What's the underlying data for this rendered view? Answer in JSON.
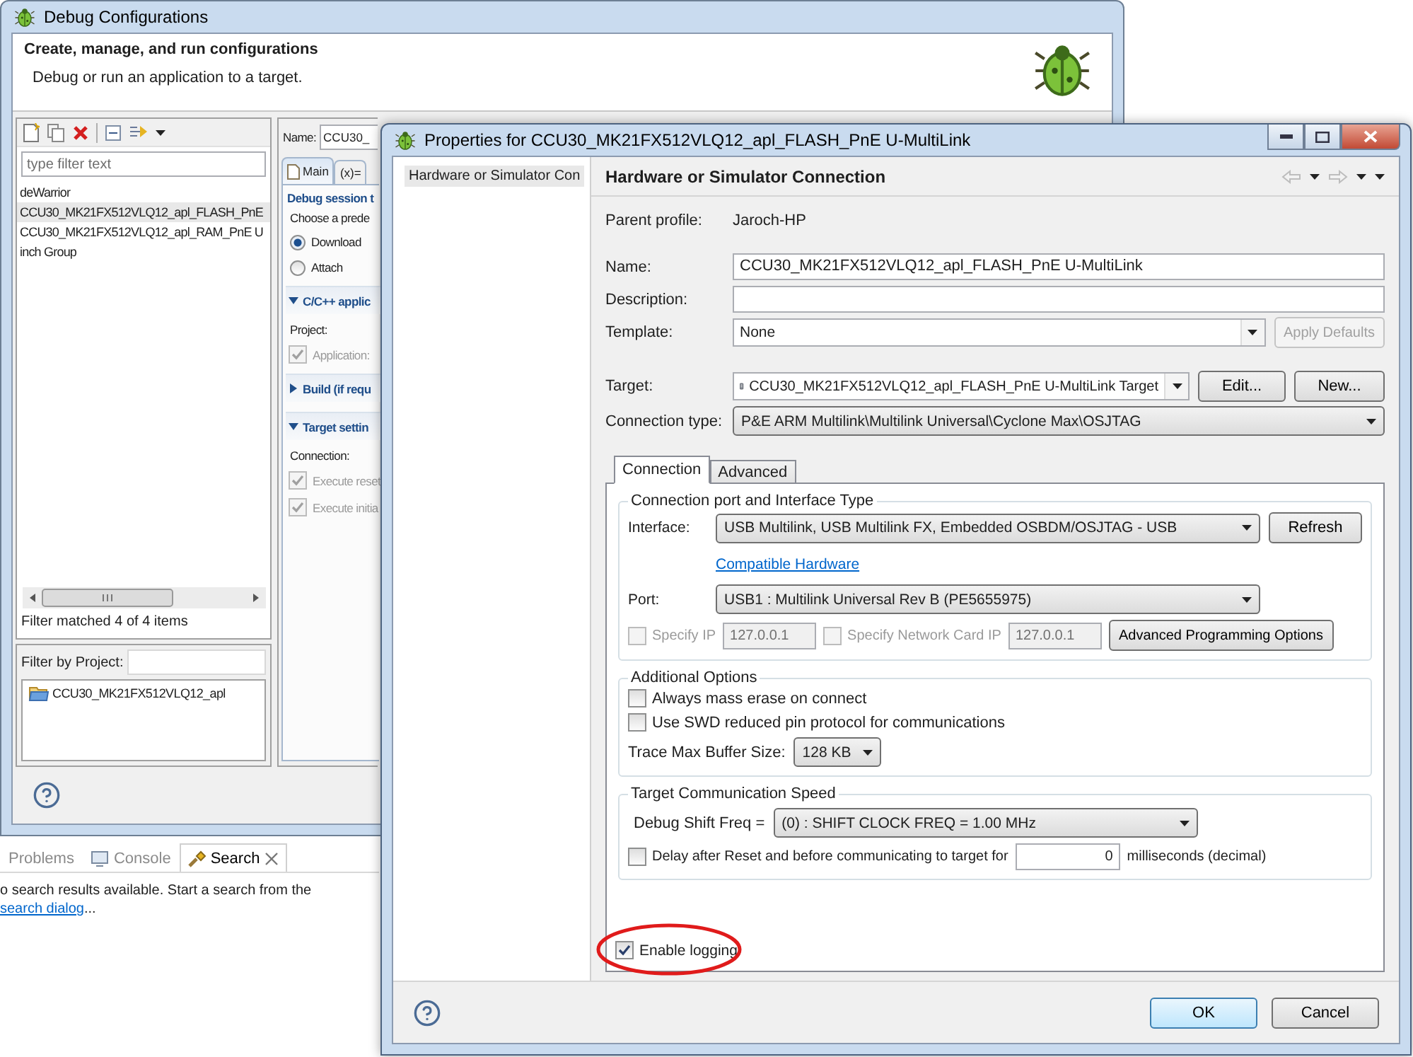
{
  "debug_window": {
    "title": "Debug Configurations",
    "heading": "Create, manage, and run configurations",
    "subheading": "Debug or run an application to a target.",
    "filter": {
      "placeholder": "type filter text"
    },
    "tree": [
      {
        "label": "deWarrior",
        "selected": false
      },
      {
        "label": "CCU30_MK21FX512VLQ12_apl_FLASH_PnE",
        "selected": true
      },
      {
        "label": "CCU30_MK21FX512VLQ12_apl_RAM_PnE U",
        "selected": false
      },
      {
        "label": "inch Group",
        "selected": false
      }
    ],
    "filter_status": "Filter matched 4 of 4 items",
    "project_filter": {
      "label": "Filter by Project:"
    },
    "projects": [
      {
        "label": "CCU30_MK21FX512VLQ12_apl"
      }
    ],
    "name": {
      "label": "Name:",
      "value": "CCU30_"
    },
    "tabs": [
      {
        "label": "Main",
        "selected": true
      },
      {
        "label": "(x)=",
        "selected": false
      }
    ],
    "main_tab": [
      {
        "kind": "section_title",
        "label": "Debug session t"
      },
      {
        "kind": "text",
        "label": "Choose a prede"
      },
      {
        "kind": "radio",
        "label": "Download",
        "selected": true
      },
      {
        "kind": "radio",
        "label": "Attach",
        "selected": false
      },
      {
        "kind": "section",
        "label": "C/C++ applic",
        "expanded": true
      },
      {
        "kind": "text",
        "label": "Project:"
      },
      {
        "kind": "checkbox",
        "label": "Application:",
        "checked": true,
        "disabled": true
      },
      {
        "kind": "section",
        "label": "Build (if requ",
        "expanded": false
      },
      {
        "kind": "section",
        "label": "Target settin",
        "expanded": true
      },
      {
        "kind": "text",
        "label": "Connection:"
      },
      {
        "kind": "checkbox",
        "label": "Execute reset",
        "checked": true,
        "disabled": true
      },
      {
        "kind": "checkbox",
        "label": "Execute initia",
        "checked": true,
        "disabled": true
      }
    ]
  },
  "bottom_view": {
    "tabs": [
      {
        "label": "Problems",
        "selected": false
      },
      {
        "label": "Console",
        "selected": false
      },
      {
        "label": "Search",
        "selected": true
      }
    ],
    "message": "o search results available. Start a search from the",
    "link": "search dialog",
    "suffix": "..."
  },
  "props_window": {
    "title": "Properties for CCU30_MK21FX512VLQ12_apl_FLASH_PnE U-MultiLink",
    "nav": [
      {
        "label": "Hardware or Simulator Con",
        "selected": true
      }
    ],
    "page_title": "Hardware or Simulator Connection",
    "parent_profile": {
      "label": "Parent profile:",
      "value": "Jaroch-HP"
    },
    "name": {
      "label": "Name:",
      "value": "CCU30_MK21FX512VLQ12_apl_FLASH_PnE U-MultiLink"
    },
    "description": {
      "label": "Description:"
    },
    "template": {
      "label": "Template:",
      "value": "None"
    },
    "apply_defaults": {
      "label": "Apply Defaults",
      "disabled": true
    },
    "target": {
      "label": "Target:",
      "value": "CCU30_MK21FX512VLQ12_apl_FLASH_PnE U-MultiLink Target"
    },
    "target_buttons": [
      "Edit...",
      "New..."
    ],
    "connection_type": {
      "label": "Connection type:",
      "value": "P&E ARM Multilink\\Multilink Universal\\Cyclone Max\\OSJTAG"
    },
    "tabs": [
      {
        "label": "Connection",
        "selected": true
      },
      {
        "label": "Advanced",
        "selected": false
      }
    ],
    "port_group": {
      "title": "Connection port and Interface Type",
      "interface": {
        "label": "Interface:",
        "value": "USB Multilink, USB Multilink FX, Embedded OSBDM/OSJTAG - USB"
      },
      "refresh": "Refresh",
      "compatible_link": "Compatible Hardware",
      "port": {
        "label": "Port:",
        "value": "USB1 : Multilink Universal Rev B (PE5655975)"
      },
      "specify_ip": {
        "label": "Specify IP",
        "checked": false,
        "disabled": true,
        "value": "127.0.0.1"
      },
      "specify_card_ip": {
        "label": "Specify Network Card IP",
        "checked": false,
        "disabled": true,
        "value": "127.0.0.1"
      },
      "advanced_button": "Advanced Programming Options"
    },
    "options_group": {
      "title": "Additional Options",
      "checkboxes": [
        {
          "label": "Always mass erase on connect",
          "checked": false
        },
        {
          "label": "Use SWD reduced pin protocol for communications",
          "checked": false
        }
      ],
      "trace_buffer": {
        "label": "Trace Max Buffer Size:",
        "value": "128 KB"
      }
    },
    "speed_group": {
      "title": "Target Communication Speed",
      "shift_freq": {
        "label": "Debug Shift Freq =",
        "value": "(0) : SHIFT CLOCK FREQ = 1.00 MHz"
      },
      "delay": {
        "label": "Delay after Reset and before communicating to target for",
        "checked": false,
        "value": "0",
        "suffix": "milliseconds (decimal)"
      }
    },
    "enable_logging": {
      "label": "Enable logging",
      "checked": true
    },
    "buttons": [
      {
        "label": "OK",
        "default": true
      },
      {
        "label": "Cancel",
        "default": false
      }
    ]
  }
}
